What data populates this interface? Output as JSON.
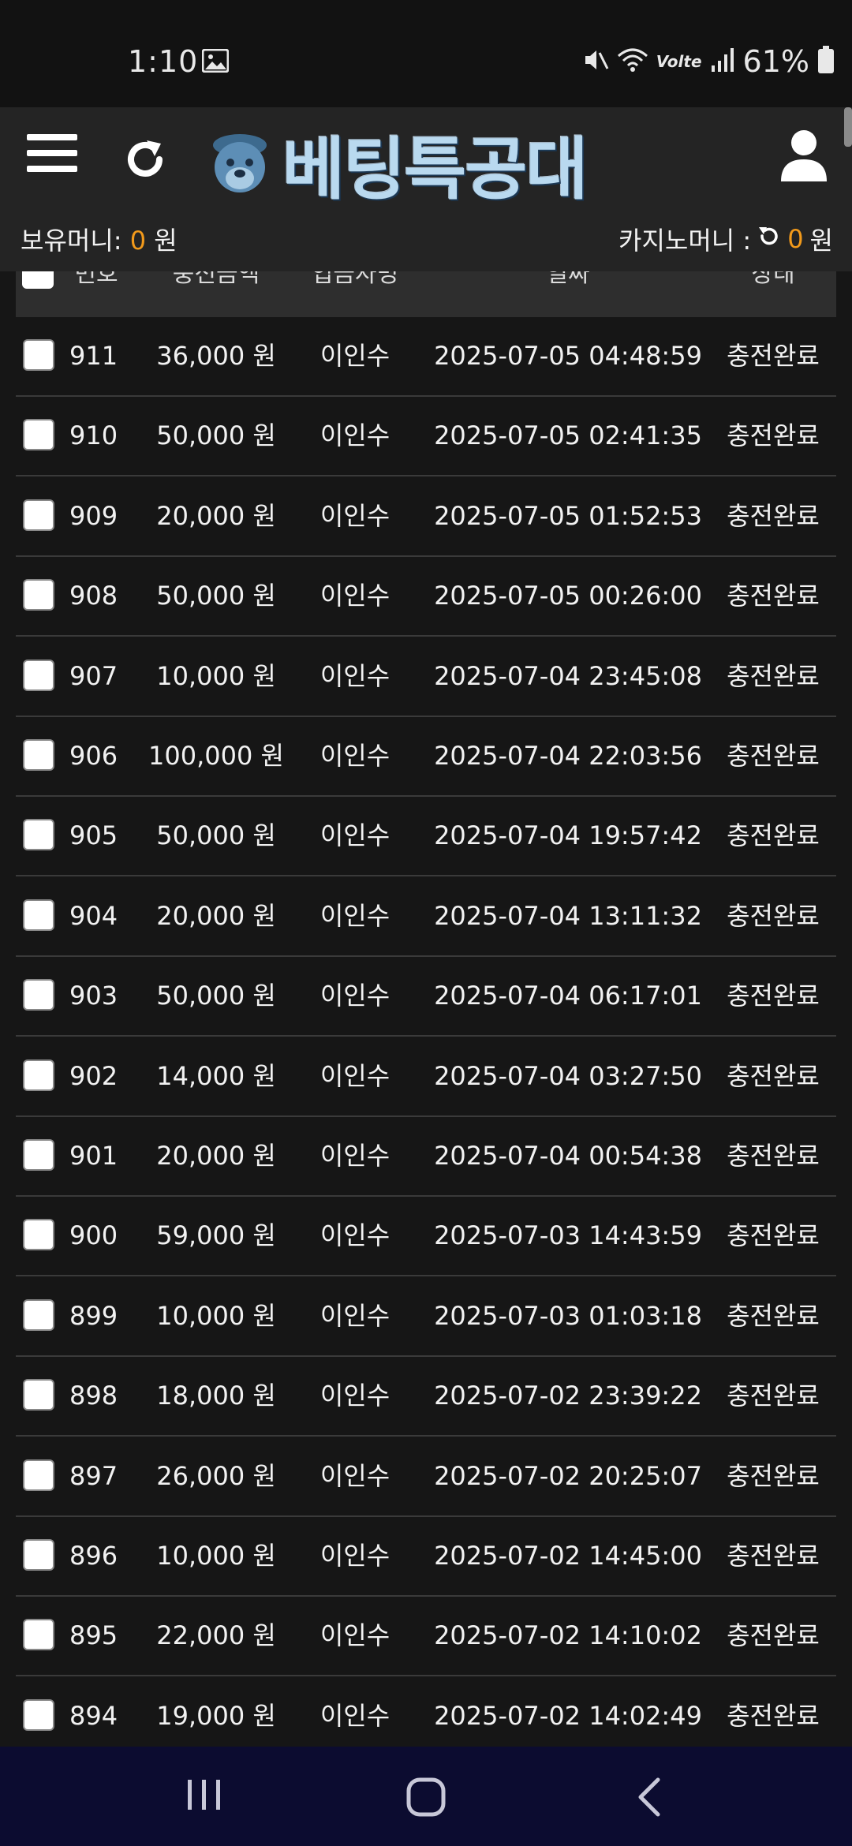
{
  "status_bar": {
    "time": "1:10",
    "battery": "61%",
    "network_label": "Volte",
    "icons": [
      "gallery-icon",
      "mute-icon",
      "wifi-icon",
      "signal-icon",
      "battery-icon"
    ]
  },
  "header": {
    "logo_text": "베팅특공대",
    "menu_icon": "hamburger-menu-icon",
    "refresh_icon": "refresh-icon",
    "user_icon": "user-profile-icon"
  },
  "wallet": {
    "holding_label": "보유머니:",
    "holding_value": "0",
    "casino_label": "카지노머니 :",
    "casino_value": "0",
    "unit": "원"
  },
  "table": {
    "columns": [
      "번호",
      "충전금액",
      "입금자명",
      "일짜",
      "상태"
    ],
    "rows": [
      {
        "no": "911",
        "amount": "36,000 원",
        "name": "이인수",
        "date": "2025-07-05 04:48:59",
        "status": "충전완료"
      },
      {
        "no": "910",
        "amount": "50,000 원",
        "name": "이인수",
        "date": "2025-07-05 02:41:35",
        "status": "충전완료"
      },
      {
        "no": "909",
        "amount": "20,000 원",
        "name": "이인수",
        "date": "2025-07-05 01:52:53",
        "status": "충전완료"
      },
      {
        "no": "908",
        "amount": "50,000 원",
        "name": "이인수",
        "date": "2025-07-05 00:26:00",
        "status": "충전완료"
      },
      {
        "no": "907",
        "amount": "10,000 원",
        "name": "이인수",
        "date": "2025-07-04 23:45:08",
        "status": "충전완료"
      },
      {
        "no": "906",
        "amount": "100,000 원",
        "name": "이인수",
        "date": "2025-07-04 22:03:56",
        "status": "충전완료"
      },
      {
        "no": "905",
        "amount": "50,000 원",
        "name": "이인수",
        "date": "2025-07-04 19:57:42",
        "status": "충전완료"
      },
      {
        "no": "904",
        "amount": "20,000 원",
        "name": "이인수",
        "date": "2025-07-04 13:11:32",
        "status": "충전완료"
      },
      {
        "no": "903",
        "amount": "50,000 원",
        "name": "이인수",
        "date": "2025-07-04 06:17:01",
        "status": "충전완료"
      },
      {
        "no": "902",
        "amount": "14,000 원",
        "name": "이인수",
        "date": "2025-07-04 03:27:50",
        "status": "충전완료"
      },
      {
        "no": "901",
        "amount": "20,000 원",
        "name": "이인수",
        "date": "2025-07-04 00:54:38",
        "status": "충전완료"
      },
      {
        "no": "900",
        "amount": "59,000 원",
        "name": "이인수",
        "date": "2025-07-03 14:43:59",
        "status": "충전완료"
      },
      {
        "no": "899",
        "amount": "10,000 원",
        "name": "이인수",
        "date": "2025-07-03 01:03:18",
        "status": "충전완료"
      },
      {
        "no": "898",
        "amount": "18,000 원",
        "name": "이인수",
        "date": "2025-07-02 23:39:22",
        "status": "충전완료"
      },
      {
        "no": "897",
        "amount": "26,000 원",
        "name": "이인수",
        "date": "2025-07-02 20:25:07",
        "status": "충전완료"
      },
      {
        "no": "896",
        "amount": "10,000 원",
        "name": "이인수",
        "date": "2025-07-02 14:45:00",
        "status": "충전완료"
      },
      {
        "no": "895",
        "amount": "22,000 원",
        "name": "이인수",
        "date": "2025-07-02 14:10:02",
        "status": "충전완료"
      },
      {
        "no": "894",
        "amount": "19,000 원",
        "name": "이인수",
        "date": "2025-07-02 14:02:49",
        "status": "충전완료"
      }
    ]
  },
  "nav_bar": {
    "icons": [
      "recent-apps-icon",
      "home-icon",
      "back-icon"
    ]
  },
  "colors": {
    "background": "#161616",
    "header": "#242424",
    "accent_money": "#f29a1b",
    "navbar": "#0c0c30"
  }
}
